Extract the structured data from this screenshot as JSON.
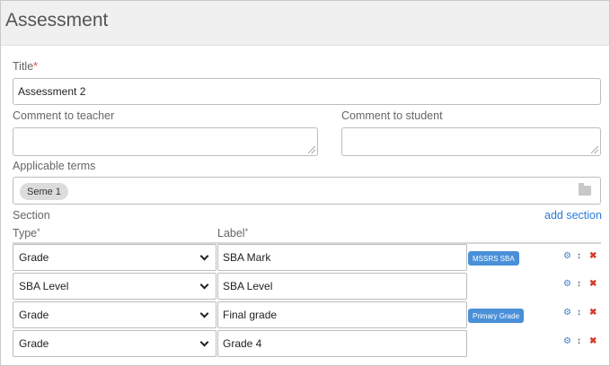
{
  "header": {
    "title": "Assessment"
  },
  "form": {
    "title_label": "Title",
    "title_required_mark": "*",
    "title_value": "Assessment 2",
    "comment_teacher_label": "Comment to teacher",
    "comment_student_label": "Comment to student",
    "terms_label": "Applicable terms",
    "terms": [
      "Seme 1"
    ]
  },
  "section": {
    "label": "Section",
    "add_link": "add section",
    "type_header": "Type",
    "label_header": "Label",
    "header_mark": "*",
    "rows": [
      {
        "type": "Grade",
        "label": "SBA Mark",
        "badge": "MSSRS SBA"
      },
      {
        "type": "SBA Level",
        "label": "SBA Level",
        "badge": ""
      },
      {
        "type": "Grade",
        "label": "Final grade",
        "badge": "Primary Grade"
      },
      {
        "type": "Grade",
        "label": "Grade 4",
        "badge": ""
      }
    ]
  },
  "icons": {
    "settings": "gear-icon",
    "reorder": "arrows-vertical-icon",
    "delete": "close-icon",
    "browse_terms": "folder-icon"
  },
  "colors": {
    "link": "#2b7bd6",
    "badge": "#4a90d9",
    "delete": "#d43b2b",
    "required": "#d9534f"
  }
}
